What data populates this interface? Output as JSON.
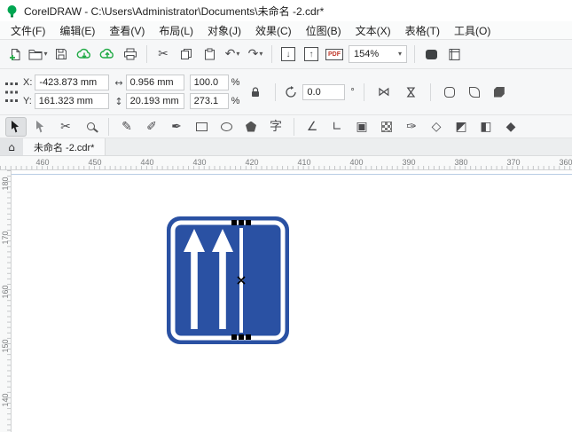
{
  "window": {
    "title": "CorelDRAW - C:\\Users\\Administrator\\Documents\\未命名 -2.cdr*"
  },
  "menubar": {
    "items": [
      {
        "id": "file",
        "label": "文件(F)"
      },
      {
        "id": "edit",
        "label": "编辑(E)"
      },
      {
        "id": "view",
        "label": "查看(V)"
      },
      {
        "id": "layout",
        "label": "布局(L)"
      },
      {
        "id": "object",
        "label": "对象(J)"
      },
      {
        "id": "effects",
        "label": "效果(C)"
      },
      {
        "id": "bitmaps",
        "label": "位图(B)"
      },
      {
        "id": "text",
        "label": "文本(X)"
      },
      {
        "id": "table",
        "label": "表格(T)"
      },
      {
        "id": "tools",
        "label": "工具(O)"
      }
    ]
  },
  "toolbar": {
    "zoom_value": "154%",
    "pdf_label": "PDF"
  },
  "icons": {
    "caret": "▾",
    "undo": "↶",
    "redo": "↷",
    "cut": "✂",
    "import_arrow": "↓",
    "export_arrow": "↑",
    "home": "⌂",
    "mirror": "⋈",
    "degree": "°",
    "width_arrow": "↔",
    "height_arrow": "↕"
  },
  "propbar": {
    "x_label": "X:",
    "x_value": "-423.873 mm",
    "y_label": "Y:",
    "y_value": "161.323 mm",
    "width_value": "0.956 mm",
    "height_value": "20.193 mm",
    "scale_h_value": "100.0",
    "scale_v_value": "273.1",
    "percent": "%",
    "rotation_value": "0.0"
  },
  "tabbar": {
    "tab_label": "未命名 -2.cdr*"
  },
  "rulers": {
    "horizontal": [
      "460",
      "450",
      "440",
      "430",
      "420",
      "410",
      "400",
      "390",
      "380",
      "370",
      "360"
    ],
    "vertical": [
      "180",
      "170",
      "160",
      "150",
      "140"
    ]
  },
  "toolbox": {
    "tools": [
      {
        "id": "pick",
        "shape": "pick",
        "active": true
      },
      {
        "id": "shape",
        "shape": "shape"
      },
      {
        "id": "crop",
        "glyph": "✂"
      },
      {
        "id": "zoom",
        "shape": "zoom"
      },
      {
        "type": "sep"
      },
      {
        "id": "freehand",
        "glyph": "✎"
      },
      {
        "id": "artistic-media",
        "glyph": "✐"
      },
      {
        "id": "pen",
        "glyph": "✒"
      },
      {
        "id": "rectangle",
        "shape": "rect"
      },
      {
        "id": "ellipse",
        "shape": "ellipse"
      },
      {
        "id": "polygon",
        "shape": "polygon"
      },
      {
        "id": "text",
        "glyph": "字"
      },
      {
        "type": "sep"
      },
      {
        "id": "parallel-dimension",
        "glyph": "∠"
      },
      {
        "id": "connector",
        "glyph": "∟"
      },
      {
        "id": "drop-shadow",
        "glyph": "▣"
      },
      {
        "id": "transparency",
        "shape": "checker"
      },
      {
        "id": "eyedropper",
        "glyph": "✑"
      },
      {
        "id": "outline-pen",
        "glyph": "◇"
      },
      {
        "id": "interactive-fill",
        "glyph": "◩"
      },
      {
        "id": "smart-fill",
        "glyph": "◧"
      },
      {
        "id": "edit-fill",
        "glyph": "◆"
      }
    ]
  },
  "sign": {
    "blue": "#2a51a3"
  }
}
